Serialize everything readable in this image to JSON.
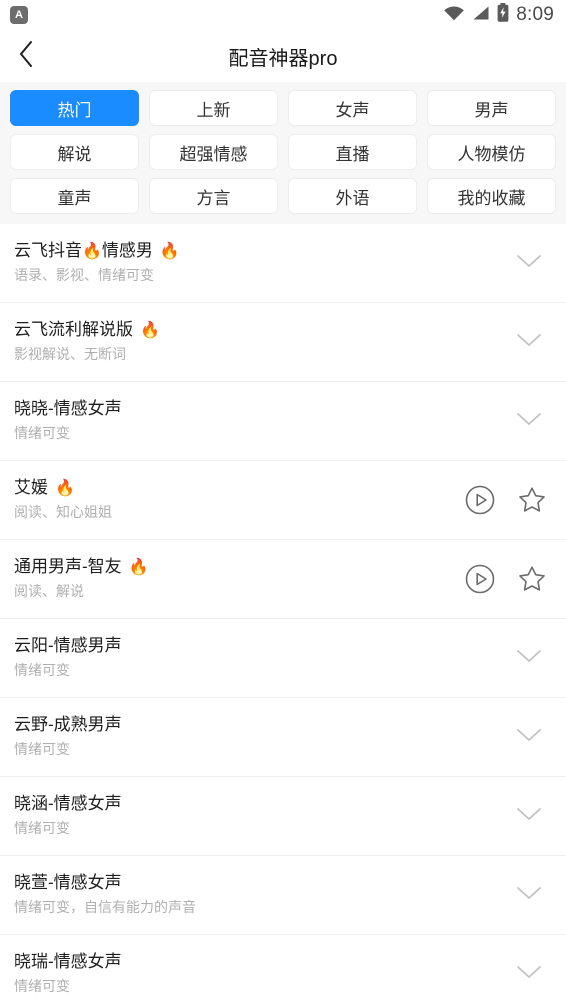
{
  "statusbar": {
    "notification_icon": "app-letter-icon",
    "notification_letter": "A",
    "wifi_icon": "wifi-icon",
    "signal_icon": "cellular-signal-icon",
    "battery_icon": "battery-charging-icon",
    "time": "8:09"
  },
  "header": {
    "back_icon": "back-chevron-icon",
    "title": "配音神器pro"
  },
  "tabs": {
    "active_index": 0,
    "accent_color": "#1a8cff",
    "items": [
      {
        "label": "热门"
      },
      {
        "label": "上新"
      },
      {
        "label": "女声"
      },
      {
        "label": "男声"
      },
      {
        "label": "解说"
      },
      {
        "label": "超强情感"
      },
      {
        "label": "直播"
      },
      {
        "label": "人物模仿"
      },
      {
        "label": "童声"
      },
      {
        "label": "方言"
      },
      {
        "label": "外语"
      },
      {
        "label": "我的收藏"
      }
    ]
  },
  "list": {
    "items": [
      {
        "title": "云飞抖音",
        "title_flame_inline": "🔥",
        "title_tail": "情感男",
        "trailing_flame": "🔥",
        "subtitle": "语录、影视、情绪可变",
        "action": "chevron"
      },
      {
        "title": "云飞流利解说版",
        "trailing_flame": "🔥",
        "subtitle": "影视解说、无断词",
        "action": "chevron"
      },
      {
        "title": "晓晓-情感女声",
        "subtitle": "情绪可变",
        "action": "chevron"
      },
      {
        "title": "艾媛",
        "trailing_flame": "🔥",
        "subtitle": "阅读、知心姐姐",
        "action": "play-favorite"
      },
      {
        "title": "通用男声-智友",
        "trailing_flame": "🔥",
        "subtitle": "阅读、解说",
        "action": "play-favorite"
      },
      {
        "title": "云阳-情感男声",
        "subtitle": "情绪可变",
        "action": "chevron"
      },
      {
        "title": "云野-成熟男声",
        "subtitle": "情绪可变",
        "action": "chevron"
      },
      {
        "title": "晓涵-情感女声",
        "subtitle": "情绪可变",
        "action": "chevron"
      },
      {
        "title": "晓萱-情感女声",
        "subtitle": "情绪可变，自信有能力的声音",
        "action": "chevron"
      },
      {
        "title": "晓瑞-情感女声",
        "subtitle": "情绪可变",
        "action": "chevron"
      }
    ],
    "icons": {
      "play": "play-circle-icon",
      "favorite": "star-outline-icon",
      "expand": "chevron-down-icon"
    }
  }
}
